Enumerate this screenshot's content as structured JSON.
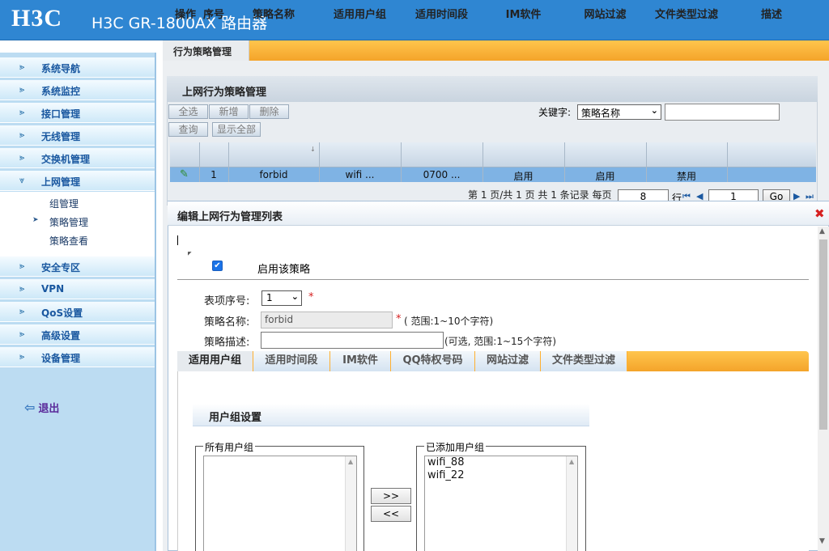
{
  "header": {
    "logo": "H3C",
    "product": "H3C GR-1800AX 路由器"
  },
  "sidebar": {
    "items": [
      {
        "label": "系统导航"
      },
      {
        "label": "系统监控"
      },
      {
        "label": "接口管理"
      },
      {
        "label": "无线管理"
      },
      {
        "label": "交换机管理"
      },
      {
        "label": "上网管理"
      },
      {
        "label": "安全专区"
      },
      {
        "label": "VPN"
      },
      {
        "label": "QoS设置"
      },
      {
        "label": "高级设置"
      },
      {
        "label": "设备管理"
      }
    ],
    "subitems": [
      {
        "label": "组管理"
      },
      {
        "label": "策略管理"
      },
      {
        "label": "策略查看"
      }
    ],
    "logout": "退出"
  },
  "tabbar": {
    "title": "行为策略管理"
  },
  "panel": {
    "title": "上网行为策略管理",
    "buttons": {
      "select_all": "全选",
      "add": "新增",
      "delete": "删除",
      "query": "查询",
      "show_all": "显示全部"
    },
    "keyword_label": "关键字:",
    "keyword_option": "策略名称",
    "keyword_value": ""
  },
  "table": {
    "columns": [
      "操作",
      "序号",
      "策略名称",
      "适用用户组",
      "适用时间段",
      "IM软件",
      "网站过滤",
      "文件类型过滤",
      "描述"
    ],
    "rows": [
      {
        "seq": "1",
        "name": "forbid",
        "group": "wifi ...",
        "time": "0700 ...",
        "im": "启用",
        "web": "启用",
        "file": "禁用",
        "desc": ""
      }
    ]
  },
  "pager": {
    "text": "第 1 页/共 1 页 共 1 条记录 每页",
    "per_page": "8",
    "row_label": "行",
    "page": "1",
    "go": "Go"
  },
  "dialog": {
    "title": "编辑上网行为管理列表",
    "enable_label": "启用该策略",
    "enabled": true,
    "fields": {
      "index_label": "表项序号:",
      "index_value": "1",
      "name_label": "策略名称:",
      "name_value": "forbid",
      "name_hint": "( 范围:1~10个字符)",
      "desc_label": "策略描述:",
      "desc_value": "",
      "desc_hint": "(可选, 范围:1~15个字符)",
      "required_mark": "*"
    },
    "tabs": [
      {
        "label": "适用用户组"
      },
      {
        "label": "适用时间段"
      },
      {
        "label": "IM软件"
      },
      {
        "label": "QQ特权号码"
      },
      {
        "label": "网站过滤"
      },
      {
        "label": "文件类型过滤"
      }
    ],
    "group_section": {
      "title": "用户组设置",
      "all_groups_legend": "所有用户组",
      "all_groups": [],
      "added_groups_legend": "已添加用户组",
      "added_groups": [
        "wifi_88",
        "wifi_22"
      ],
      "add_btn": ">>",
      "remove_btn": "<<"
    }
  },
  "colors": {
    "header": "#2f86d2",
    "accent_orange": "#f4a42a",
    "sidebar": "#bcdcf2",
    "row_selected": "#7fb3e4",
    "required": "#d62020"
  }
}
